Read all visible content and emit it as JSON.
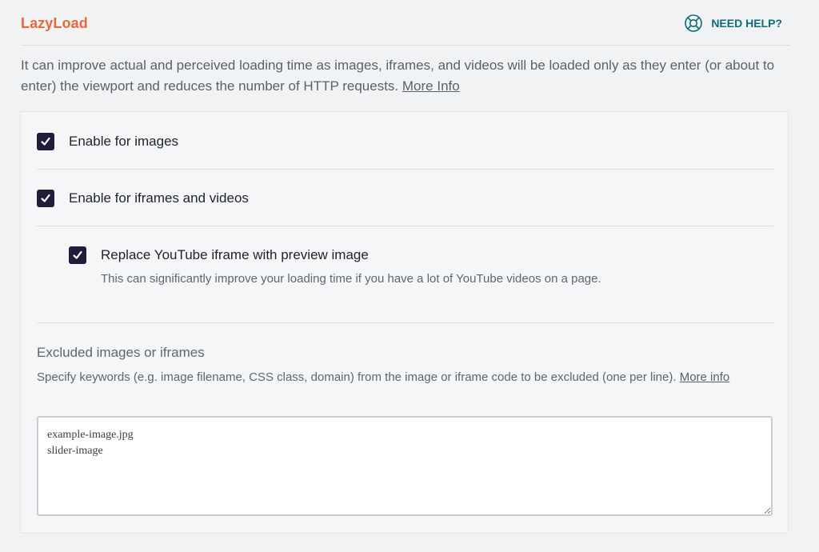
{
  "header": {
    "title": "LazyLoad",
    "help_label": "NEED HELP?",
    "help_icon": "lifebuoy-icon",
    "accent_color": "#e8683a",
    "help_color": "#0b6d7b"
  },
  "description": {
    "text": "It can improve actual and perceived loading time as images, iframes, and videos will be loaded only as they enter (or about to enter) the viewport and reduces the number of HTTP requests.",
    "link_label": "More Info"
  },
  "options": {
    "images": {
      "label": "Enable for images",
      "checked": true
    },
    "iframes": {
      "label": "Enable for iframes and videos",
      "checked": true
    },
    "youtube": {
      "label": "Replace YouTube iframe with preview image",
      "checked": true,
      "description": "This can significantly improve your loading time if you have a lot of YouTube videos on a page."
    }
  },
  "excluded": {
    "title": "Excluded images or iframes",
    "help": "Specify keywords (e.g. image filename, CSS class, domain) from the image or iframe code to be excluded (one per line).",
    "link_label": "More info",
    "value": "example-image.jpg\nslider-image"
  },
  "checkbox_color": "#1f1d3a"
}
